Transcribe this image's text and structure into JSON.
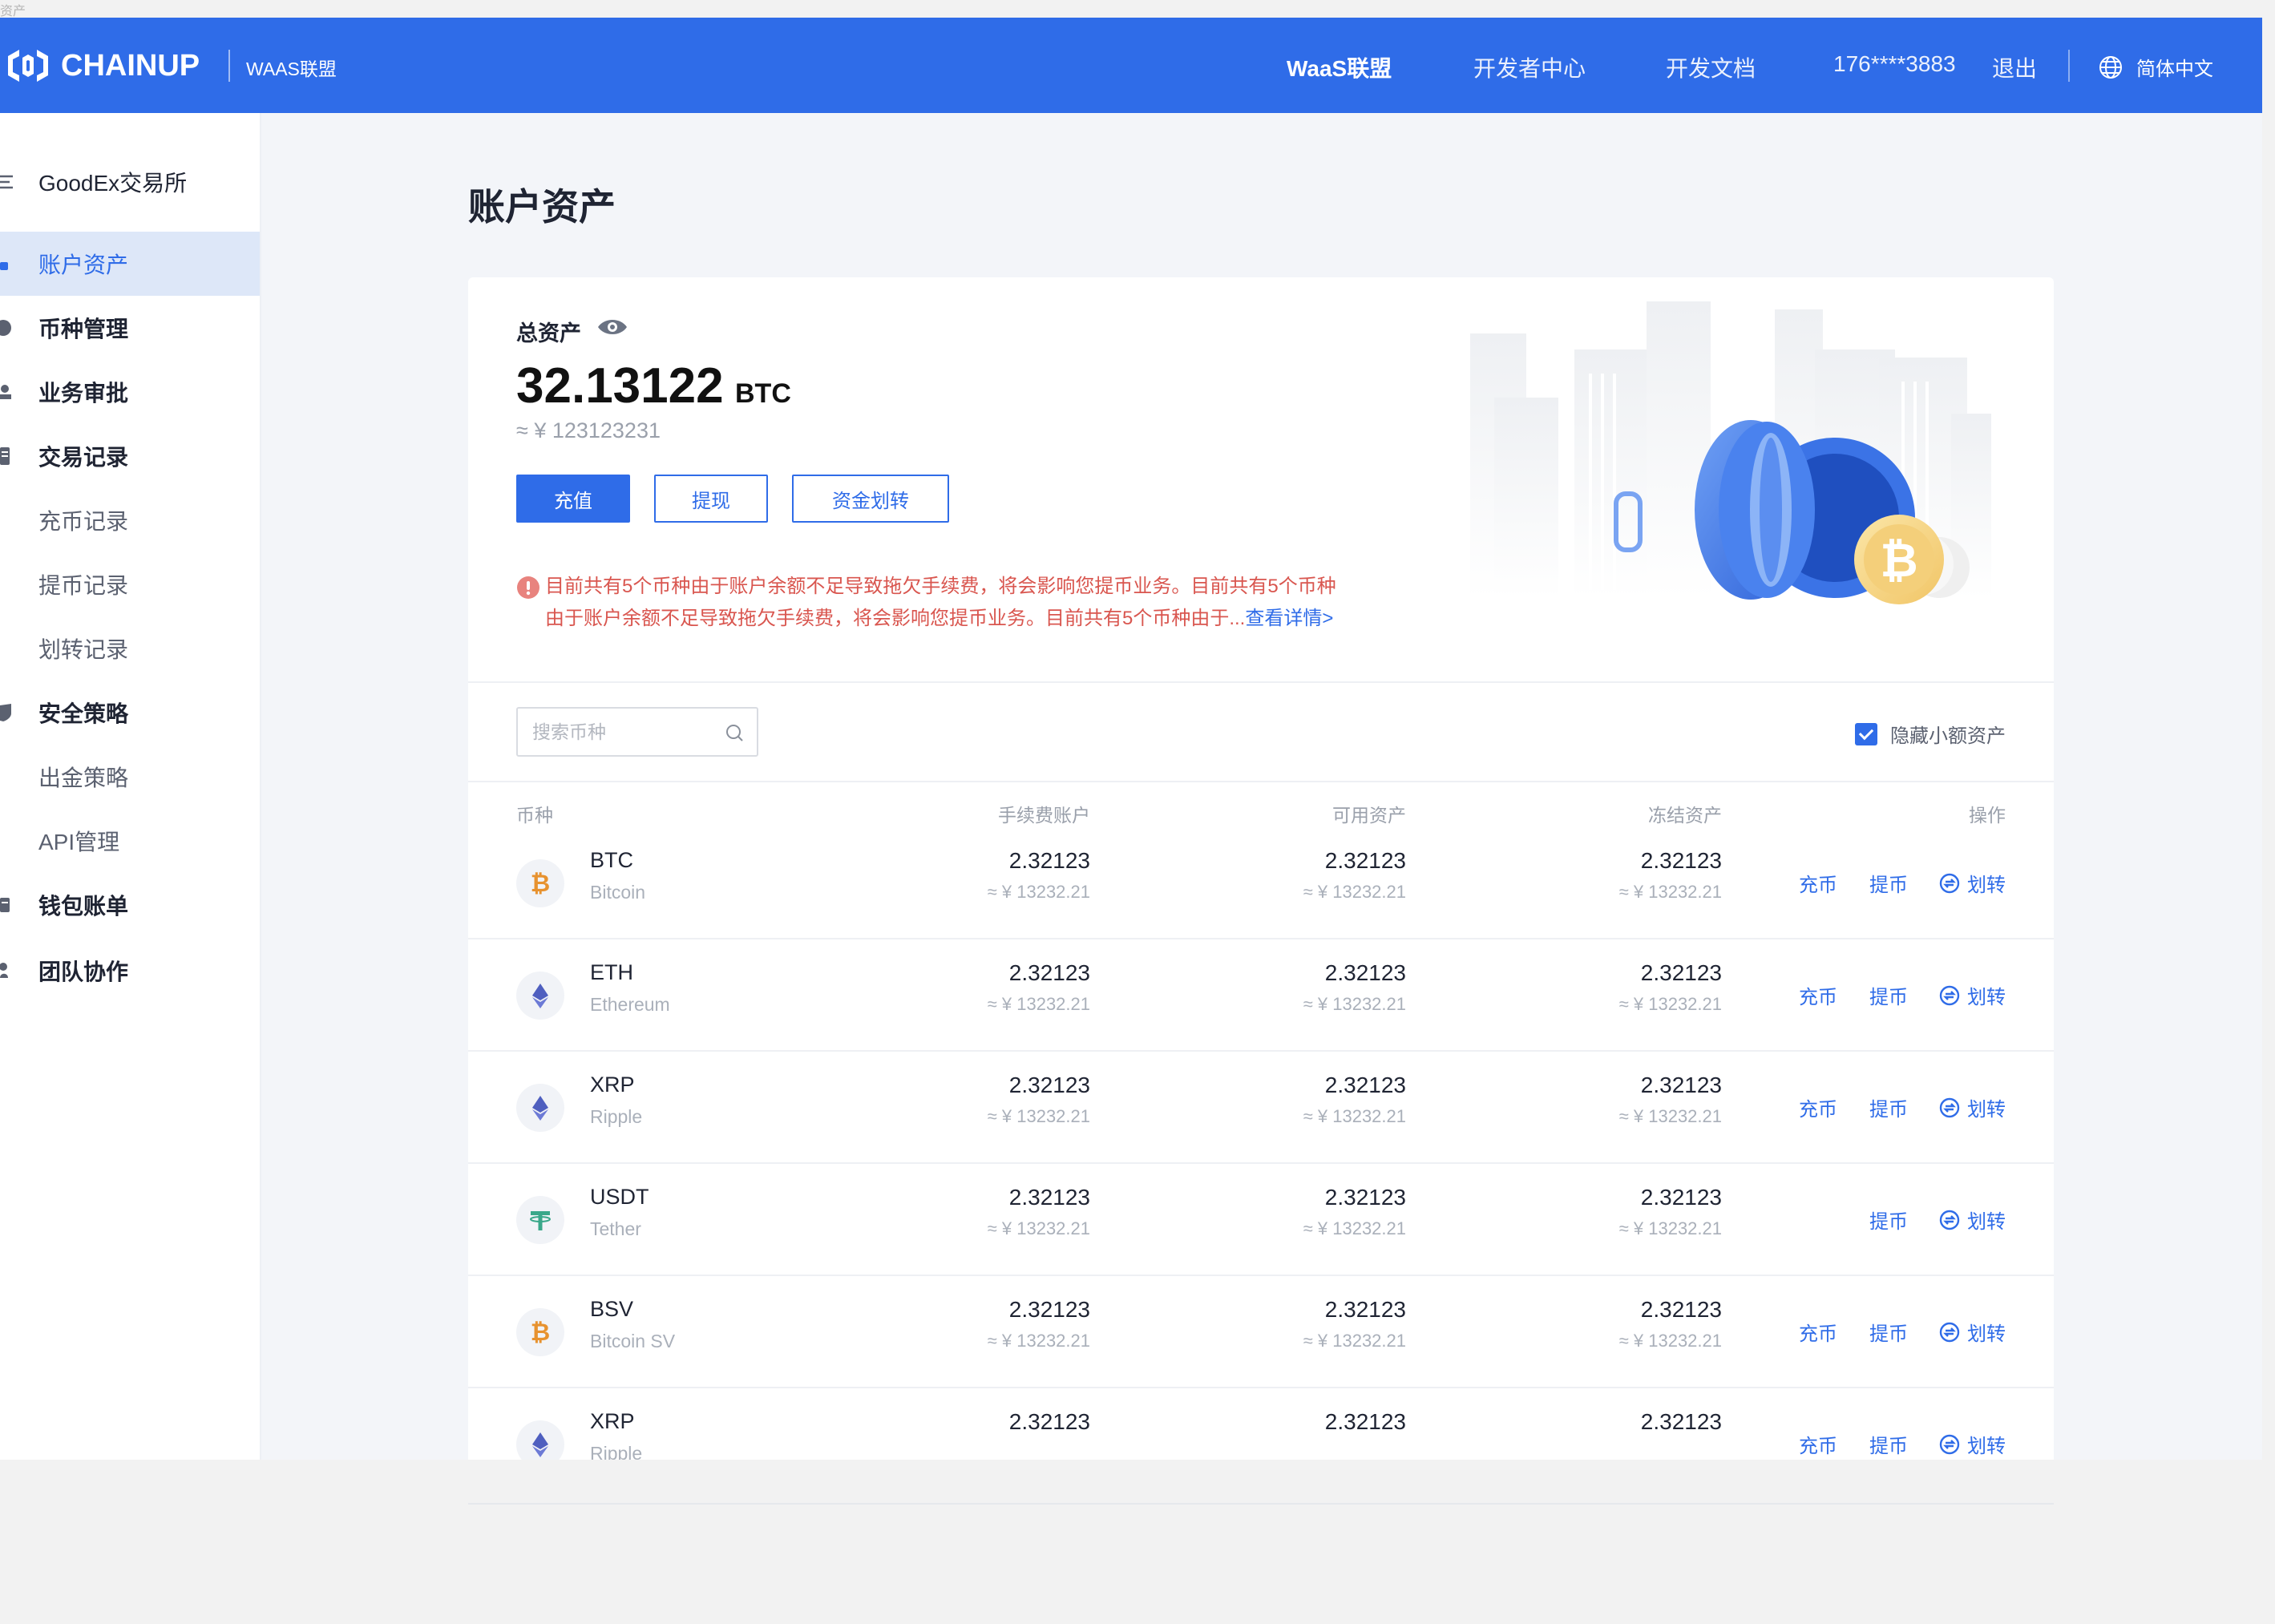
{
  "window": {
    "tiny_title": "资产"
  },
  "topbar": {
    "brand_name": "CHAINUP",
    "brand_sub": "WAAS联盟",
    "nav": [
      "WaaS联盟",
      "开发者中心",
      "开发文档"
    ],
    "phone": "176****3883",
    "logout": "退出",
    "language": "简体中文",
    "bg_color": "#2f6ce8"
  },
  "sidebar": {
    "org": "GoodEx交易所",
    "items": [
      {
        "label": "账户资产",
        "active": true,
        "icon": "wallet-icon"
      },
      {
        "label": "币种管理",
        "icon": "coin-icon"
      },
      {
        "label": "业务审批",
        "icon": "stamp-icon"
      },
      {
        "label": "交易记录",
        "icon": "list-icon"
      },
      {
        "label": "充币记录",
        "sub": true
      },
      {
        "label": "提币记录",
        "sub": true
      },
      {
        "label": "划转记录",
        "sub": true
      },
      {
        "label": "安全策略",
        "icon": "shield-icon"
      },
      {
        "label": "出金策略",
        "sub": true
      },
      {
        "label": "API管理",
        "sub": true
      },
      {
        "label": "钱包账单",
        "icon": "bill-icon"
      },
      {
        "label": "团队协作",
        "icon": "team-icon"
      }
    ]
  },
  "main": {
    "page_title": "账户资产",
    "total": {
      "label": "总资产",
      "value": "32.13122",
      "unit": "BTC",
      "cny": "≈ ¥ 123123231"
    },
    "buttons": {
      "deposit": "充值",
      "withdraw": "提现",
      "transfer": "资金划转"
    },
    "warning": {
      "text": "目前共有5个币种由于账户余额不足导致拖欠手续费，将会影响您提币业务。目前共有5个币种由于账户余额不足导致拖欠手续费，将会影响您提币业务。目前共有5个币种由于...",
      "link": "查看详情>"
    },
    "search": {
      "placeholder": "搜索币种"
    },
    "hide_small": {
      "label": "隐藏小额资产",
      "checked": true
    },
    "columns": [
      "币种",
      "手续费账户",
      "可用资产",
      "冻结资产",
      "操作"
    ],
    "actions": {
      "deposit": "充币",
      "withdraw": "提币",
      "transfer": "划转"
    },
    "rows": [
      {
        "symbol": "BTC",
        "name": "Bitcoin",
        "icon": "btc-icon",
        "fee": "2.32123",
        "fee_cny": "≈ ¥ 13232.21",
        "avail": "2.32123",
        "avail_cny": "≈ ¥ 13232.21",
        "frozen": "2.32123",
        "frozen_cny": "≈ ¥ 13232.21",
        "can_deposit": true
      },
      {
        "symbol": "ETH",
        "name": "Ethereum",
        "icon": "eth-icon",
        "fee": "2.32123",
        "fee_cny": "≈ ¥ 13232.21",
        "avail": "2.32123",
        "avail_cny": "≈ ¥ 13232.21",
        "frozen": "2.32123",
        "frozen_cny": "≈ ¥ 13232.21",
        "can_deposit": true
      },
      {
        "symbol": "XRP",
        "name": "Ripple",
        "icon": "eth-icon",
        "fee": "2.32123",
        "fee_cny": "≈ ¥ 13232.21",
        "avail": "2.32123",
        "avail_cny": "≈ ¥ 13232.21",
        "frozen": "2.32123",
        "frozen_cny": "≈ ¥ 13232.21",
        "can_deposit": true
      },
      {
        "symbol": "USDT",
        "name": "Tether",
        "icon": "usdt-icon",
        "fee": "2.32123",
        "fee_cny": "≈ ¥ 13232.21",
        "avail": "2.32123",
        "avail_cny": "≈ ¥ 13232.21",
        "frozen": "2.32123",
        "frozen_cny": "≈ ¥ 13232.21",
        "can_deposit": false
      },
      {
        "symbol": "BSV",
        "name": "Bitcoin SV",
        "icon": "btc-icon",
        "fee": "2.32123",
        "fee_cny": "≈ ¥ 13232.21",
        "avail": "2.32123",
        "avail_cny": "≈ ¥ 13232.21",
        "frozen": "2.32123",
        "frozen_cny": "≈ ¥ 13232.21",
        "can_deposit": true
      },
      {
        "symbol": "XRP",
        "name": "Ripple",
        "icon": "eth-icon",
        "fee": "2.32123",
        "fee_cny": "",
        "avail": "2.32123",
        "avail_cny": "",
        "frozen": "2.32123",
        "frozen_cny": "",
        "can_deposit": true
      }
    ]
  }
}
